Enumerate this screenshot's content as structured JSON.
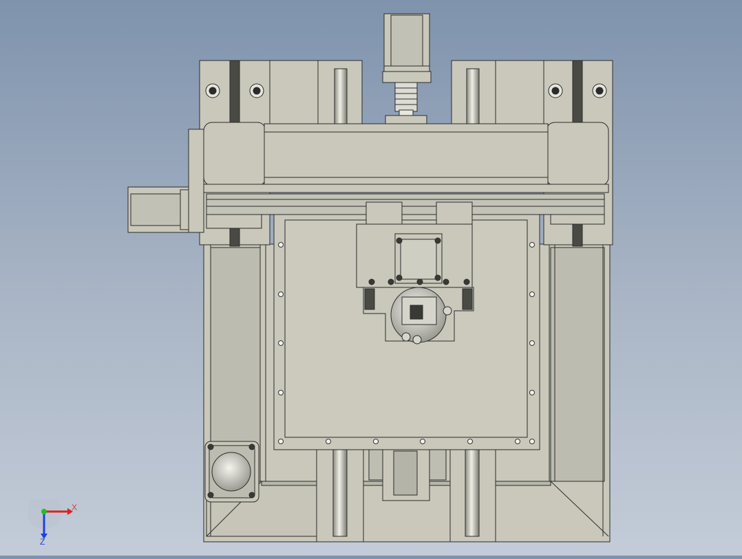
{
  "view": {
    "background_top": "#7f93ad",
    "background_bottom": "#c3ccd8",
    "part_fill": "#c9c8bb",
    "part_stroke": "#2b2b2b"
  },
  "triad": {
    "x_label": "X",
    "z_label": "Z",
    "x_color": "#e02020",
    "y_color": "#20c020",
    "z_color": "#2040e0"
  }
}
